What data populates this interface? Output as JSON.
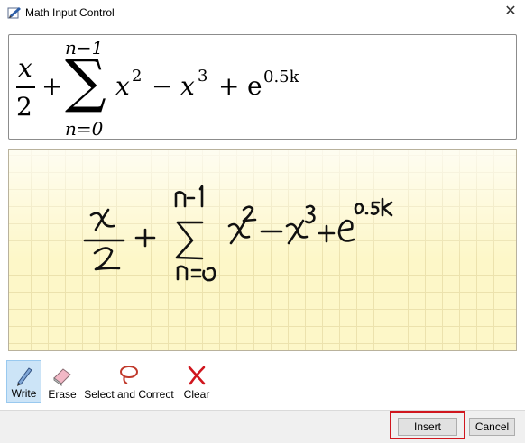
{
  "window": {
    "title": "Math Input Control",
    "close_glyph": "✕"
  },
  "preview": {
    "frac_num": "x",
    "frac_den": "2",
    "plus": "+",
    "sum_upper": "n−1",
    "sum_symbol": "∑",
    "sum_lower": "n=0",
    "x_var": "x",
    "exp2": "2",
    "minus": "−",
    "x_var2": "x",
    "exp3": "3",
    "plus2": "+",
    "e_const": "e",
    "e_exp": "0.5k"
  },
  "ink": {
    "background_color": "#fdf7c8",
    "grid_color": "#ece2ad",
    "stroke_color": "#111111"
  },
  "toolbar": {
    "tools": [
      {
        "label": "Write",
        "icon": "pen-icon",
        "active": true
      },
      {
        "label": "Erase",
        "icon": "eraser-icon",
        "active": false
      },
      {
        "label": "Select and Correct",
        "icon": "lasso-icon",
        "active": false
      },
      {
        "label": "Clear",
        "icon": "clear-x-icon",
        "active": false
      }
    ]
  },
  "buttons": {
    "insert": "Insert",
    "cancel": "Cancel"
  },
  "highlight_color": "#d0161e"
}
